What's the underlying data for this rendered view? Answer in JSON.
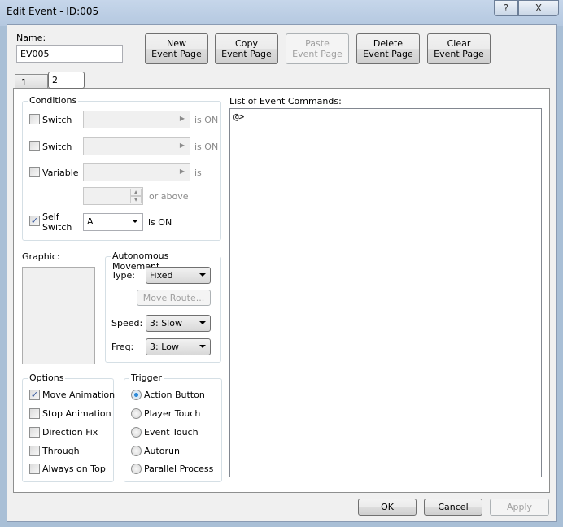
{
  "window": {
    "title": "Edit Event - ID:005",
    "help": "?",
    "close": "X"
  },
  "name": {
    "label": "Name:",
    "value": "EV005"
  },
  "toolbar": {
    "new": [
      "New",
      "Event Page"
    ],
    "copy": [
      "Copy",
      "Event Page"
    ],
    "paste": [
      "Paste",
      "Event Page"
    ],
    "delete": [
      "Delete",
      "Event Page"
    ],
    "clear": [
      "Clear",
      "Event Page"
    ]
  },
  "tabs": [
    "1",
    "2"
  ],
  "conditions": {
    "title": "Conditions",
    "switch1": "Switch",
    "switch2": "Switch",
    "variable": "Variable",
    "is_on": "is ON",
    "is": "is",
    "or_above": "or above",
    "self_switch": [
      "Self",
      "Switch"
    ],
    "self_switch_value": "A",
    "self_is_on": "is ON"
  },
  "graphic": {
    "label": "Graphic:"
  },
  "movement": {
    "title": "Autonomous Movement",
    "type_label": "Type:",
    "type": "Fixed",
    "move_route": "Move Route...",
    "speed_label": "Speed:",
    "speed": "3: Slow",
    "freq_label": "Freq:",
    "freq": "3: Low"
  },
  "options": {
    "title": "Options",
    "items": [
      {
        "label": "Move Animation",
        "checked": true
      },
      {
        "label": "Stop Animation",
        "checked": false
      },
      {
        "label": "Direction Fix",
        "checked": false
      },
      {
        "label": "Through",
        "checked": false
      },
      {
        "label": "Always on Top",
        "checked": false
      }
    ]
  },
  "trigger": {
    "title": "Trigger",
    "items": [
      "Action Button",
      "Player Touch",
      "Event Touch",
      "Autorun",
      "Parallel Process"
    ],
    "selected": 0
  },
  "commands": {
    "label": "List of Event Commands:",
    "items": [
      "@>"
    ]
  },
  "footer": {
    "ok": "OK",
    "cancel": "Cancel",
    "apply": "Apply"
  }
}
